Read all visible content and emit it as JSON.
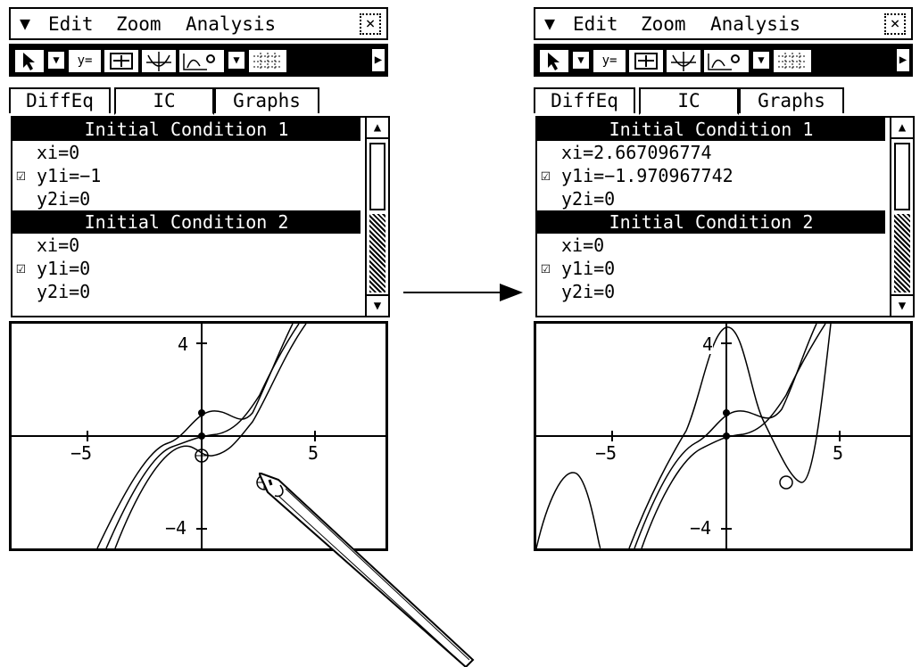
{
  "menu": {
    "edit": "Edit",
    "zoom": "Zoom",
    "analysis": "Analysis",
    "close": "×"
  },
  "tabs": {
    "diffeq": "DiffEq",
    "ic": "IC",
    "graphs": "Graphs"
  },
  "toolbar": {
    "pointer": "pointer-icon",
    "table": "y=",
    "zoom_box": "zoom-box-icon",
    "axes": "axes-icon",
    "solution": "solution-curve-icon",
    "grid": "grid-icon"
  },
  "axis_labels": {
    "y_top": "4",
    "y_bottom": "−4",
    "x_left": "−5",
    "x_right": "5"
  },
  "left": {
    "ic1_header": "Initial Condition 1",
    "ic1_xi": "xi=0",
    "ic1_y1i": "y1i=−1",
    "ic1_y2i": "y2i=0",
    "ic2_header": "Initial Condition 2",
    "ic2_xi": "xi=0",
    "ic2_y1i": "y1i=0",
    "ic2_y2i": "y2i=0"
  },
  "right": {
    "ic1_header": "Initial Condition 1",
    "ic1_xi": "xi=2.667096774",
    "ic1_y1i": "y1i=−1.970967742",
    "ic1_y2i": "y2i=0",
    "ic2_header": "Initial Condition 2",
    "ic2_xi": "xi=0",
    "ic2_y1i": "y1i=0",
    "ic2_y2i": "y2i=0"
  },
  "checkbox_glyph": "☑"
}
